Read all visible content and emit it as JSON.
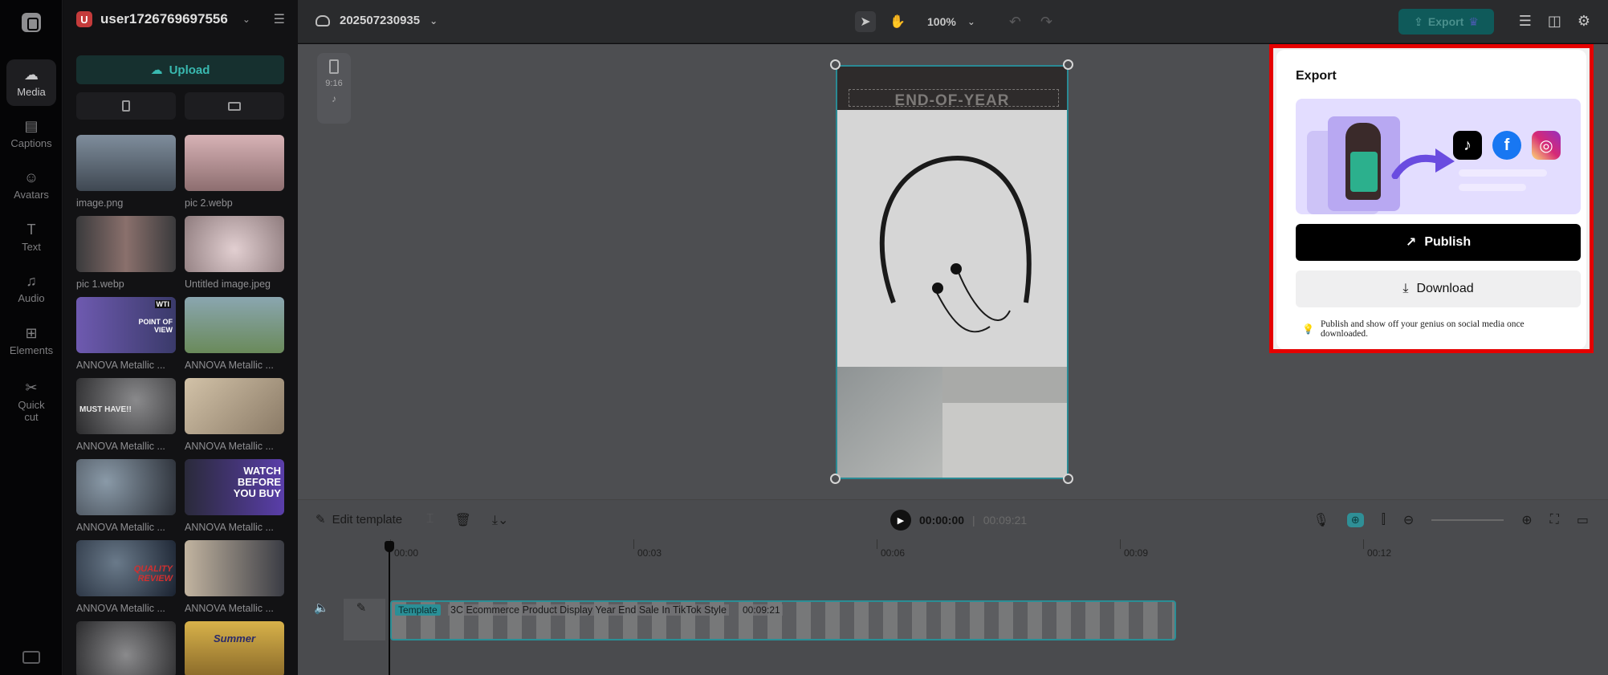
{
  "sidebar": {
    "items": [
      {
        "label": "Media",
        "icon": "cloud-upload-icon"
      },
      {
        "label": "Captions",
        "icon": "captions-icon"
      },
      {
        "label": "Avatars",
        "icon": "avatar-icon"
      },
      {
        "label": "Text",
        "icon": "text-icon"
      },
      {
        "label": "Audio",
        "icon": "music-note-icon"
      },
      {
        "label": "Elements",
        "icon": "elements-icon"
      },
      {
        "label": "Quick cut",
        "icon": "quick-cut-icon"
      }
    ]
  },
  "panel": {
    "user_initial": "U",
    "user_name": "user1726769697556",
    "upload_label": "Upload",
    "media": [
      {
        "caption": "image.png",
        "color": "#5b6572"
      },
      {
        "caption": "pic 2.webp",
        "color": "#bfa2a4"
      },
      {
        "caption": "pic 1.webp",
        "color": "#6c5a57"
      },
      {
        "caption": "Untitled image.jpeg",
        "color": "#b8a6a8"
      },
      {
        "caption": "ANNOVA Metallic ...",
        "color": "#5a4a8a"
      },
      {
        "caption": "ANNOVA Metallic ...",
        "color": "#7a8a6a"
      },
      {
        "caption": "ANNOVA Metallic ...",
        "color": "#4a4a4c"
      },
      {
        "caption": "ANNOVA Metallic ...",
        "color": "#a89a86"
      },
      {
        "caption": "ANNOVA Metallic ...",
        "color": "#5a5e66"
      },
      {
        "caption": "ANNOVA Metallic ...",
        "color": "#5a3e8a"
      },
      {
        "caption": "ANNOVA Metallic ...",
        "color": "#3c4a5a"
      },
      {
        "caption": "ANNOVA Metallic ...",
        "color": "#7a7270"
      },
      {
        "caption": "",
        "color": "#4a4a4c"
      },
      {
        "caption": "",
        "color": "#a88a3a"
      }
    ],
    "thumb_overlays": {
      "t4a": "WTI",
      "t4b": "POINT OF VIEW",
      "t6": "MUST HAVE!!",
      "t9": "WATCH BEFORE YOU BUY",
      "t10": "QUALITY REVIEW",
      "t13": "Summer"
    }
  },
  "topbar": {
    "project_name": "202507230935",
    "zoom": "100%",
    "export_label": "Export"
  },
  "canvas": {
    "ratio_label": "9:16",
    "banner_text": "END-OF-YEAR"
  },
  "export_panel": {
    "title": "Export",
    "publish_label": "Publish",
    "download_label": "Download",
    "tip": "Publish and show off your genius on social media once downloaded."
  },
  "timeline_bar": {
    "edit_template_label": "Edit template",
    "current_time": "00:00:00",
    "separator": "|",
    "total_time": "00:09:21"
  },
  "timeline": {
    "ticks": [
      "00:00",
      "00:03",
      "00:06",
      "00:09",
      "00:12"
    ],
    "clip_tag": "Template",
    "clip_name": "3C Ecommerce Product Display Year End Sale In TikTok Style",
    "clip_duration": "00:09:21"
  }
}
